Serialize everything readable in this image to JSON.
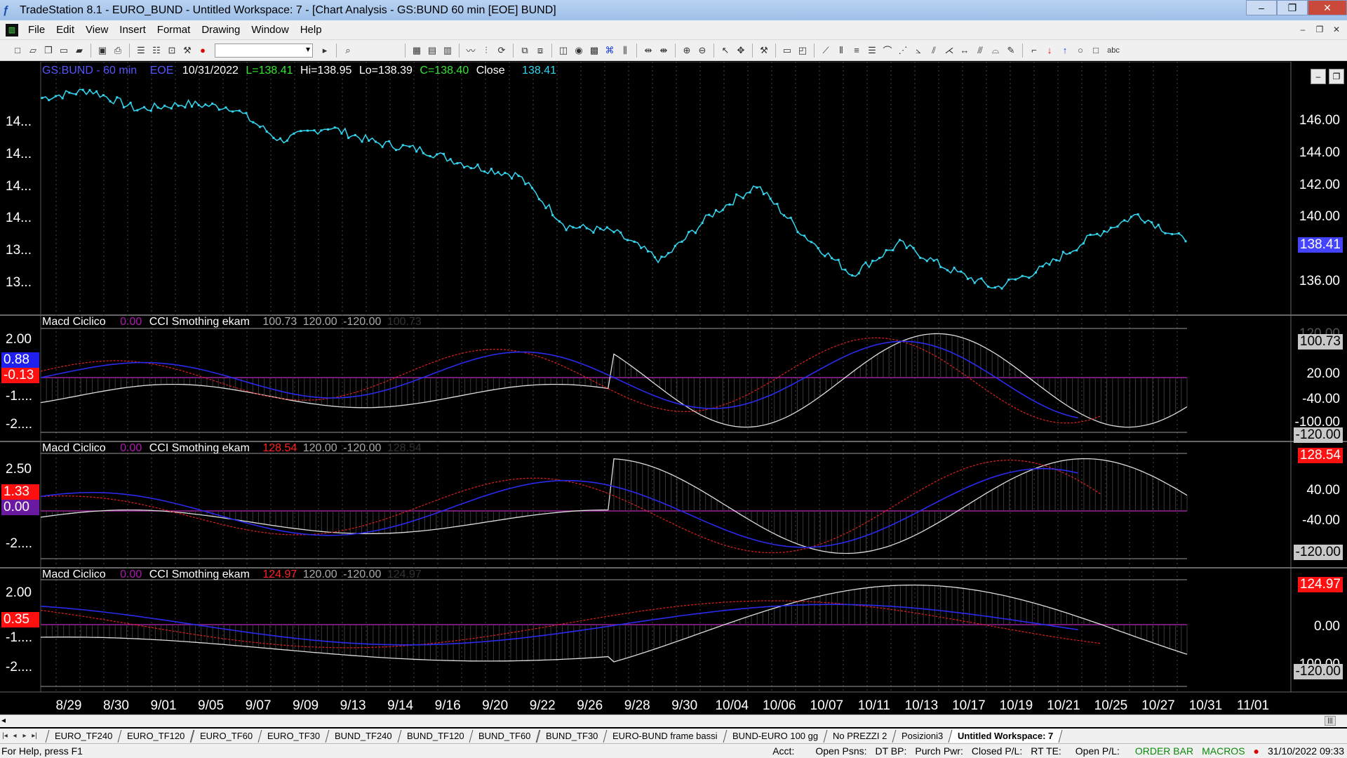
{
  "window": {
    "title": "TradeStation 8.1 - EURO_BUND - Untitled Workspace:  7 - [Chart Analysis - GS:BUND  60 min  [EOE] BUND]",
    "minimize": "–",
    "restore": "❐",
    "close": "✕"
  },
  "menu": [
    "File",
    "Edit",
    "View",
    "Insert",
    "Format",
    "Drawing",
    "Window",
    "Help"
  ],
  "header": {
    "symbol": "GS:BUND - 60 min",
    "session": "EOE",
    "date": "10/31/2022",
    "low_label": "L=138.41",
    "high_label": "Hi=138.95",
    "lo_label": "Lo=138.39",
    "close_label": "C=138.40",
    "close_word": "Close",
    "last": "138.41"
  },
  "price_axis": {
    "left_labels": [
      "14...",
      "14...",
      "14...",
      "14...",
      "13...",
      "13..."
    ],
    "right_labels": [
      "146.00",
      "144.00",
      "142.00",
      "140.00",
      "136.00"
    ],
    "tag": "138.41",
    "tag_color": "#4444ff"
  },
  "subpanels": [
    {
      "name": "Macd Ciclico",
      "v1": "0.00",
      "ind": "CCI Smothing ekam",
      "v2": "100.73",
      "v3": "120.00",
      "v4": "-120.00",
      "v5": "100.73",
      "left_labels": [
        "2.00",
        "-1....",
        "-2...."
      ],
      "tag_a": "0.88",
      "tag_b": "-0.13",
      "right_labels": [
        "120.00",
        "20.00",
        "-40.00",
        "-100.00"
      ],
      "tag_r1": "100.73",
      "tag_r2": "-120.00"
    },
    {
      "name": "Macd Ciclico",
      "v1": "0.00",
      "ind": "CCI Smothing ekam",
      "v2": "128.54",
      "v3": "120.00",
      "v4": "-120.00",
      "v5": "128.54",
      "left_labels": [
        "2.50",
        "-2...."
      ],
      "tag_a": "1.33",
      "tag_b": "0.00",
      "right_labels": [
        "40.00",
        "-40.00"
      ],
      "tag_r1": "128.54",
      "tag_r2": "-120.00"
    },
    {
      "name": "Macd Ciclico",
      "v1": "0.00",
      "ind": "CCI Smothing ekam",
      "v2": "124.97",
      "v3": "120.00",
      "v4": "-120.00",
      "v5": "124.97",
      "left_labels": [
        "2.00",
        "-1....",
        "-2...."
      ],
      "tag_a": "0.35",
      "tag_b": "",
      "right_labels": [
        "0.00",
        "-100.00"
      ],
      "tag_r1": "124.97",
      "tag_r2": "-120.00"
    }
  ],
  "dates": [
    "8/29",
    "8/30",
    "9/01",
    "9/05",
    "9/07",
    "9/09",
    "9/13",
    "9/14",
    "9/16",
    "9/20",
    "9/22",
    "9/26",
    "9/28",
    "9/30",
    "10/04",
    "10/06",
    "10/07",
    "10/11",
    "10/13",
    "10/17",
    "10/19",
    "10/21",
    "10/25",
    "10/27",
    "10/31",
    "11/01"
  ],
  "chart_data": {
    "type": "line",
    "title": "",
    "series": [
      {
        "name": "GS:BUND - 60 min",
        "color": "#33d6f0",
        "x": [
          "8/29",
          "8/30",
          "9/01",
          "9/05",
          "9/07",
          "9/09",
          "9/13",
          "9/14",
          "9/16",
          "9/20",
          "9/22",
          "9/26",
          "9/28",
          "9/30",
          "10/04",
          "10/06",
          "10/07",
          "10/11",
          "10/13",
          "10/17",
          "10/19",
          "10/21",
          "10/25",
          "10/27",
          "10/31"
        ],
        "values": [
          145.8,
          146.2,
          145.2,
          145.5,
          145.3,
          143.6,
          144.3,
          143.5,
          143.1,
          142.3,
          141.8,
          139.2,
          138.9,
          137.4,
          139.7,
          141.3,
          138.7,
          136.7,
          138.3,
          137.0,
          136.0,
          137.0,
          138.6,
          139.8,
          138.41
        ]
      }
    ],
    "ylim": [
      135.0,
      147.3
    ],
    "grid": "vertical dotted"
  },
  "tabs": [
    "EURO_TF240",
    "EURO_TF120",
    "EURO_TF60",
    "EURO_TF30",
    "BUND_TF240",
    "BUND_TF120",
    "BUND_TF60",
    "BUND_TF30",
    "EURO-BUND frame bassi",
    "BUND-EURO 100 gg",
    "No PREZZI 2",
    "Posizioni3",
    "Untitled Workspace:  7"
  ],
  "status": {
    "help": "For Help, press F1",
    "acct": "Acct:",
    "open_psns": "Open Psns:",
    "dt_bp": "DT BP:",
    "purch_pwr": "Purch Pwr:",
    "closed_pl": "Closed P/L:",
    "rt_te": "RT TE:",
    "open_pl": "Open P/L:",
    "order_bar": "ORDER BAR",
    "macros": "MACROS",
    "datetime": "31/10/2022 09:33"
  }
}
